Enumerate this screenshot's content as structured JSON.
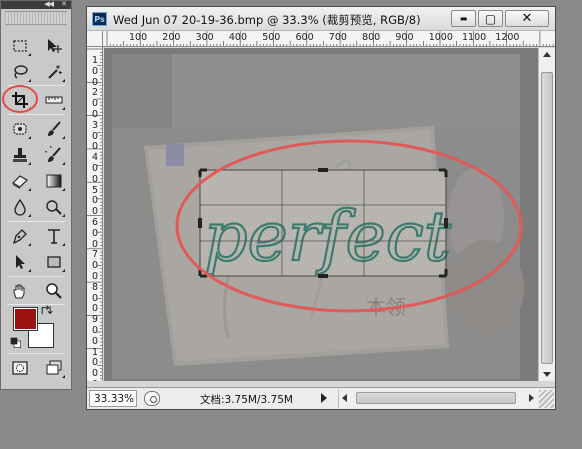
{
  "window": {
    "title": "Wed Jun 07 20-19-36.bmp @ 33.3% (裁剪预览, RGB/8)",
    "app_badge": "Ps",
    "minimize_glyph": "▬",
    "maximize_glyph": "▢",
    "close_glyph": "✕"
  },
  "toolbox": {
    "collapse_glyph": "◀◀",
    "close_glyph": "✕",
    "tools": [
      {
        "name": "rectangular-marquee-icon"
      },
      {
        "name": "move-icon"
      },
      {
        "name": "lasso-icon"
      },
      {
        "name": "magic-wand-icon"
      },
      {
        "name": "crop-icon",
        "selected": true
      },
      {
        "name": "ruler-icon"
      },
      {
        "name": "spot-healing-icon"
      },
      {
        "name": "brush-icon"
      },
      {
        "name": "clone-stamp-icon"
      },
      {
        "name": "history-brush-icon"
      },
      {
        "name": "eraser-icon"
      },
      {
        "name": "gradient-icon"
      },
      {
        "name": "blur-icon"
      },
      {
        "name": "dodge-icon"
      },
      {
        "name": "pen-icon"
      },
      {
        "name": "type-icon"
      },
      {
        "name": "path-selection-icon"
      },
      {
        "name": "rectangle-shape-icon"
      },
      {
        "name": "hand-icon"
      },
      {
        "name": "zoom-icon"
      },
      {
        "name": "quick-mask-icon"
      },
      {
        "name": "screen-mode-icon"
      }
    ],
    "foreground_color": "#9b1212",
    "background_color": "#ffffff",
    "highlight_color": "#e24a4a"
  },
  "ruler_h_labels": [
    "100",
    "200",
    "300",
    "400",
    "500",
    "600",
    "700",
    "800",
    "900",
    "1000",
    "1100",
    "1200"
  ],
  "ruler_v_labels": [
    "1",
    "0",
    "0",
    "2",
    "0",
    "0",
    "3",
    "0",
    "0",
    "4",
    "0",
    "0",
    "5",
    "0",
    "0",
    "6",
    "0",
    "0",
    "7",
    "0",
    "0",
    "8",
    "0",
    "0",
    "9",
    "0",
    "0",
    "1",
    "0",
    "0",
    "0"
  ],
  "canvas": {
    "image_text": "perfect",
    "stamp_text": "本领"
  },
  "status": {
    "zoom": "33.33%",
    "doc_info": "文档:3.75M/3.75M"
  }
}
